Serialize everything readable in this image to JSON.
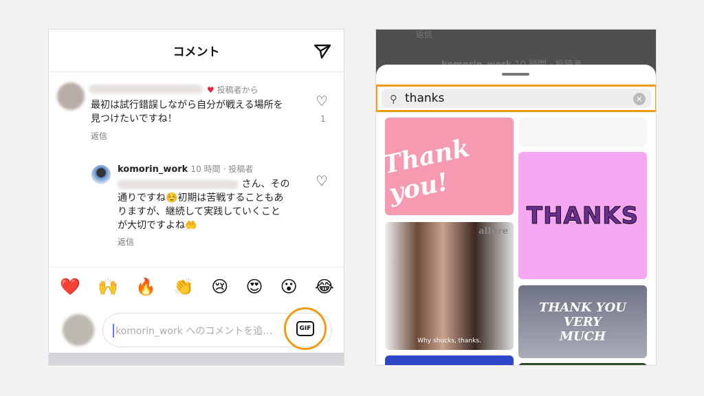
{
  "left": {
    "title": "コメント",
    "comment1": {
      "badge": "投稿者から",
      "text_line1": "最初は試行錯誤しながら自分が戦える場所を",
      "text_line2": "見つけたいですね！",
      "likes": "1",
      "reply": "返信"
    },
    "comment2": {
      "username": "komorin_work",
      "time": "10 時間",
      "role": "· 投稿者",
      "text_line1": "さん、その",
      "text_line2": "通りですね☺️初期は苦戦することもあ",
      "text_line3": "りますが、継続して実践していくこと",
      "text_line4": "が大切ですよね🤲",
      "reply": "返信"
    },
    "emojis": [
      "❤️",
      "🙌",
      "🔥",
      "👏",
      "😢",
      "😍",
      "😮",
      "😂"
    ],
    "input": {
      "placeholder": "komorin_work へのコメントを追…",
      "gif_label": "GIF"
    }
  },
  "right": {
    "background": {
      "reply": "返信",
      "username": "komorin_work",
      "meta": "10 時間 · 投稿者"
    },
    "search": {
      "value": "thanks"
    },
    "gifs": [
      {
        "text": "Thank you!",
        "bg": "#f59ab0"
      },
      {
        "text": "allure",
        "caption": "Why shucks, thanks."
      },
      {
        "text": "THANKS",
        "bg": "#f7a8f2"
      },
      {
        "text": "THANK YOU VERY MUCH"
      }
    ]
  },
  "colors": {
    "accent": "#f39a10",
    "heart": "#e8213a"
  }
}
